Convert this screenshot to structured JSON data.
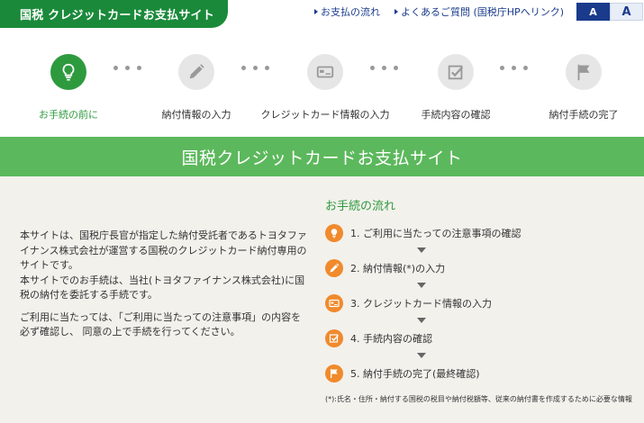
{
  "header": {
    "site_title": "国税 クレジットカードお支払サイト",
    "links": [
      {
        "label": "お支払の流れ"
      },
      {
        "label": "よくあるご質問 (国税庁HPへリンク)"
      }
    ],
    "font_size_buttons": [
      {
        "label": "A",
        "selected": true
      },
      {
        "label": "A",
        "selected": false
      }
    ]
  },
  "steps": [
    {
      "label": "お手続の前に",
      "icon": "lightbulb-icon",
      "active": true
    },
    {
      "label": "納付情報の入力",
      "icon": "pencil-icon",
      "active": false
    },
    {
      "label": "クレジットカード情報の入力",
      "icon": "credit-card-icon",
      "active": false
    },
    {
      "label": "手続内容の確認",
      "icon": "checkbox-icon",
      "active": false
    },
    {
      "label": "納付手続の完了",
      "icon": "flag-icon",
      "active": false
    }
  ],
  "banner": {
    "title": "国税クレジットカードお支払サイト"
  },
  "intro": {
    "paragraph1": "本サイトは、国税庁長官が指定した納付受託者であるトヨタファイナンス株式会社が運営する国税のクレジットカード納付専用のサイトです。",
    "paragraph2": "本サイトでのお手続は、当社(トヨタファイナンス株式会社)に国税の納付を委託する手続です。",
    "paragraph3": "ご利用に当たっては、「ご利用に当たっての注意事項」の内容を必ず確認し、 同意の上で手続を行ってください。"
  },
  "flow": {
    "title": "お手続の流れ",
    "items": [
      {
        "label": "1. ご利用に当たっての注意事項の確認",
        "icon": "lightbulb-icon"
      },
      {
        "label": "2. 納付情報(*)の入力",
        "icon": "pencil-icon"
      },
      {
        "label": "3. クレジットカード情報の入力",
        "icon": "credit-card-icon"
      },
      {
        "label": "4. 手続内容の確認",
        "icon": "checkbox-icon"
      },
      {
        "label": "5. 納付手続の完了(最終確認)",
        "icon": "flag-icon"
      }
    ],
    "note": "(*):氏名・住所・納付する国税の税目や納付税額等、従来の納付書を作成するために必要な情報"
  },
  "colors": {
    "brand_green": "#1a8a3a",
    "banner_green": "#5cb85c",
    "active_step": "#2e9a3e",
    "flow_icon_orange": "#f08a2c",
    "link_blue": "#1a3b8c"
  }
}
